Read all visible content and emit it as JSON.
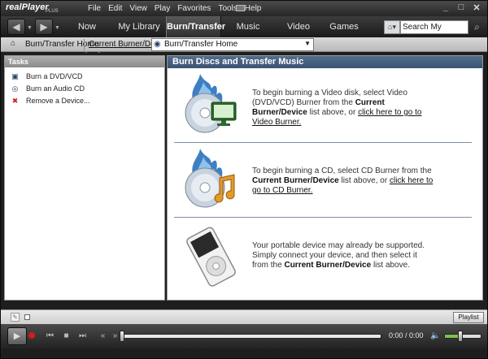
{
  "app": {
    "logo_text": "realPlayer",
    "logo_suffix": "PLUS"
  },
  "menu": [
    "File",
    "Edit",
    "View",
    "Play",
    "Favorites",
    "Tools",
    "Help"
  ],
  "window_controls": [
    "_",
    "□",
    "✕"
  ],
  "nav": {
    "tabs": [
      {
        "label": "Now Playing"
      },
      {
        "label": "My Library"
      },
      {
        "label": "Burn/Transfer"
      },
      {
        "label": "Music"
      },
      {
        "label": "Video"
      },
      {
        "label": "Games"
      }
    ],
    "active_tab": "Burn/Transfer",
    "search_placeholder": "Search My Library"
  },
  "breadcrumb": {
    "current": "Burn/Transfer Home",
    "device_label": "Current Burner/Device",
    "device_selected": "Burn/Transfer Home"
  },
  "tasks": {
    "header": "Tasks",
    "items": [
      {
        "label": "Burn a DVD/VCD",
        "icon": "dvd-icon"
      },
      {
        "label": "Burn an Audio CD",
        "icon": "audio-cd-icon"
      },
      {
        "label": "Remove a Device...",
        "icon": "remove-device-icon"
      }
    ]
  },
  "main": {
    "header": "Burn Discs and Transfer Music",
    "video": {
      "t1": "To begin burning a Video disk, select Video (DVD/VCD) Burner from the ",
      "b1": "Current Burner/Device",
      "t2": " list above, or ",
      "link": "click here to go to Video Burner."
    },
    "cd": {
      "t1": "To begin burning a CD, select CD Burner from the ",
      "b1": "Current Burner/Device",
      "t2": " list above, or ",
      "link": "click here to go to CD Burner."
    },
    "portable": {
      "t1": "Your portable device may already be supported. Simply connect your device, and then select it from the ",
      "b1": "Current Burner/Device",
      "t2": " list above."
    }
  },
  "player": {
    "playlist_label": "Playlist",
    "time": "0:00 / 0:00",
    "seek_fraction": 0,
    "volume_fraction": 0.45
  },
  "colors": {
    "main_header": "#3b5371",
    "record": "#d21c1c",
    "volume": "#7cc04b"
  }
}
